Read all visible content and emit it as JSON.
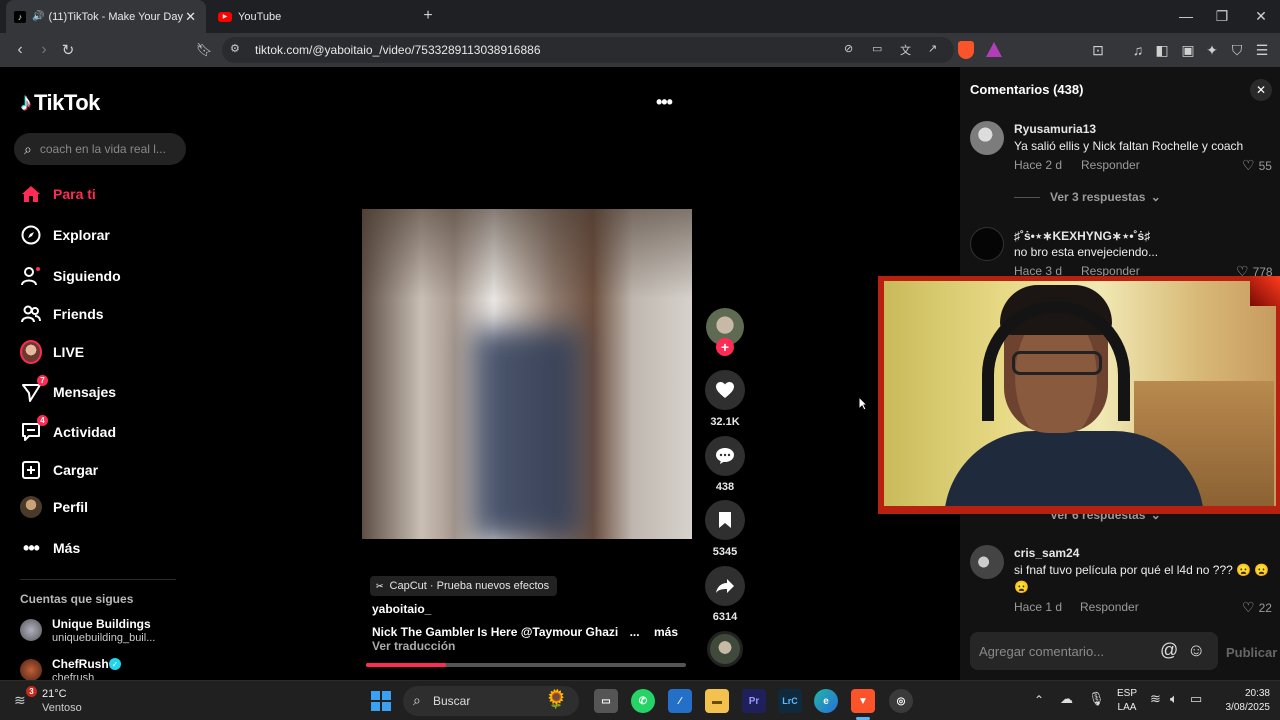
{
  "browser": {
    "tabs": [
      {
        "title": "(11)TikTok - Make Your Day",
        "active": true
      },
      {
        "title": "YouTube",
        "active": false
      }
    ],
    "url": "tiktok.com/@yaboitaio_/video/7533289113038916886",
    "window_controls": [
      "minimize-icon",
      "restore-icon",
      "close-icon"
    ]
  },
  "sidebar": {
    "logo": "TikTok",
    "search_placeholder": "coach en la vida real l...",
    "nav": [
      {
        "label": "Para ti",
        "icon": "home-icon",
        "active": true
      },
      {
        "label": "Explorar",
        "icon": "compass-icon"
      },
      {
        "label": "Siguiendo",
        "icon": "following-icon"
      },
      {
        "label": "Friends",
        "icon": "friends-icon"
      },
      {
        "label": "LIVE",
        "icon": "live-avatar-icon"
      },
      {
        "label": "Mensajes",
        "icon": "messages-icon",
        "badge": "7"
      },
      {
        "label": "Actividad",
        "icon": "activity-icon",
        "badge": "4"
      },
      {
        "label": "Cargar",
        "icon": "upload-icon"
      },
      {
        "label": "Perfil",
        "icon": "profile-icon"
      },
      {
        "label": "Más",
        "icon": "more-icon"
      }
    ],
    "following_title": "Cuentas que sigues",
    "following": [
      {
        "name": "Unique Buildings",
        "handle": "uniquebuilding_buil..."
      },
      {
        "name": "ChefRush",
        "handle": "chefrush",
        "verified": true
      }
    ]
  },
  "video": {
    "effect_label": "CapCut · Prueba nuevos efectos",
    "author": "yaboitaio_",
    "caption": "Nick The Gambler Is Here @Taymour Ghazi",
    "caption_ellipsis": "...",
    "more": "más",
    "translate": "Ver traducción",
    "progress": 0.25,
    "actions": {
      "likes": "32.1K",
      "comments": "438",
      "saves": "5345",
      "shares": "6314"
    }
  },
  "comments_panel": {
    "title": "Comentarios (438)",
    "reply_label": "Responder",
    "items": [
      {
        "user": "Ryusamuria13",
        "text": "Ya salió ellis y Nick faltan Rochelle y coach",
        "time": "Hace 2 d",
        "likes": "55",
        "replies": "Ver 3 respuestas"
      },
      {
        "user": "♯˚ṡ•⋆∗KEXHYNG∗⋆•˚ṡ♯",
        "text": "no bro esta envejeciendo...",
        "time": "Hace 3 d",
        "likes": "778",
        "replies": "Ver 6 respuestas"
      },
      {
        "user": "cris_sam24",
        "text": "si fnaf tuvo película por qué el l4d no ??? 😦 😦",
        "text2": "😦",
        "time": "Hace 1 d",
        "likes": "22"
      }
    ],
    "input_placeholder": "Agregar comentario...",
    "publish": "Publicar"
  },
  "taskbar": {
    "weather_temp": "21°C",
    "weather_desc": "Ventoso",
    "weather_badge": "3",
    "search_label": "Buscar",
    "lang_line1": "ESP",
    "lang_line2": "LAA",
    "time": "20:38",
    "date": "3/08/2025"
  }
}
